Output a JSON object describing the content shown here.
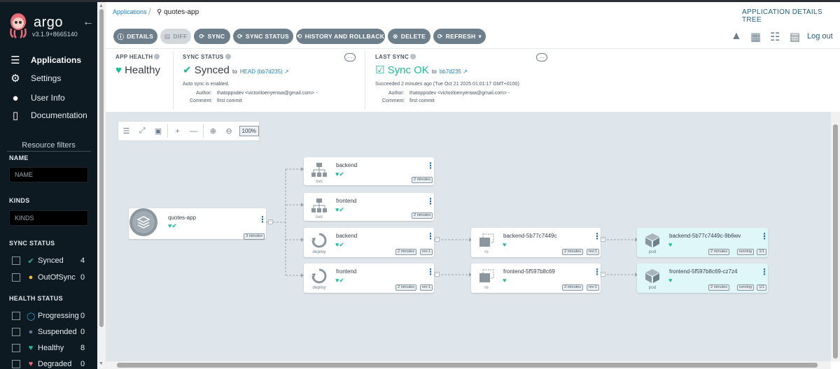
{
  "app": {
    "brand": "argo",
    "version": "v3.1.9+8665140"
  },
  "nav": [
    {
      "label": "Applications",
      "icon": "stack-icon"
    },
    {
      "label": "Settings",
      "icon": "gear-icon"
    },
    {
      "label": "User Info",
      "icon": "user-icon"
    },
    {
      "label": "Documentation",
      "icon": "book-icon"
    }
  ],
  "filters": {
    "title": "Resource filters",
    "name_label": "NAME",
    "name_placeholder": "NAME",
    "kinds_label": "KINDS",
    "kinds_placeholder": "KINDS",
    "sync_status_label": "SYNC STATUS",
    "sync_status": [
      {
        "label": "Synced",
        "count": "4",
        "icon": "check-circle-icon",
        "color": "#18be94"
      },
      {
        "label": "OutOfSync",
        "count": "0",
        "icon": "arrow-up-circle-icon",
        "color": "#f4c030"
      }
    ],
    "health_status_label": "HEALTH STATUS",
    "health_status": [
      {
        "label": "Progressing",
        "count": "0",
        "icon": "progress-icon",
        "color": "#0dadea"
      },
      {
        "label": "Suspended",
        "count": "0",
        "icon": "pause-icon",
        "color": "#766f94"
      },
      {
        "label": "Healthy",
        "count": "8",
        "icon": "heart-icon",
        "color": "#18be94"
      },
      {
        "label": "Degraded",
        "count": "0",
        "icon": "broken-heart-icon",
        "color": "#e96d76"
      }
    ]
  },
  "header": {
    "breadcrumb_root": "Applications",
    "app_name": "quotes-app",
    "view_title": "APPLICATION DETAILS TREE",
    "logout": "Log out"
  },
  "actions": [
    {
      "label": "DETAILS",
      "icon": "info-icon"
    },
    {
      "label": "DIFF",
      "icon": "file-icon",
      "disabled": true
    },
    {
      "label": "SYNC",
      "icon": "sync-icon"
    },
    {
      "label": "SYNC STATUS",
      "icon": "sync-icon"
    },
    {
      "label": "HISTORY AND ROLLBACK",
      "icon": "history-icon"
    },
    {
      "label": "DELETE",
      "icon": "delete-icon"
    },
    {
      "label": "REFRESH",
      "icon": "refresh-icon"
    }
  ],
  "health": {
    "label": "APP HEALTH",
    "value": "Healthy"
  },
  "sync_status": {
    "label": "SYNC STATUS",
    "value": "Synced",
    "to": "to",
    "revision": "HEAD (bb7d235)",
    "auto": "Auto sync is enabled.",
    "author_label": "Author:",
    "author": "thatoppsdev <victoriloenyenwa@gmail.com> -",
    "comment_label": "Comment:",
    "comment": "first commit"
  },
  "last_sync": {
    "label": "LAST SYNC",
    "value": "Sync OK",
    "to": "to",
    "revision": "bb7d235",
    "time": "Succeeded 2 minutes ago (Tue Oct 21 2025 01:01:17 GMT+0100)",
    "author_label": "Author:",
    "author": "thatoppsdev <victoriloenyenwa@gmail.com> -",
    "comment_label": "Comment:",
    "comment": "first commit"
  },
  "graph": {
    "zoom": "100%",
    "nodes": [
      {
        "id": "app",
        "name": "quotes-app",
        "kind": "",
        "age": "3 minutes"
      },
      {
        "id": "svc-backend",
        "name": "backend",
        "kind": "svc",
        "age": "2 minutes"
      },
      {
        "id": "svc-frontend",
        "name": "frontend",
        "kind": "svc",
        "age": "2 minutes"
      },
      {
        "id": "deploy-backend",
        "name": "backend",
        "kind": "deploy",
        "age": "2 minutes",
        "rev": "rev:1"
      },
      {
        "id": "deploy-frontend",
        "name": "frontend",
        "kind": "deploy",
        "age": "2 minutes",
        "rev": "rev:1"
      },
      {
        "id": "rs-backend",
        "name": "backend-5b77c7449c",
        "kind": "rs",
        "age": "2 minutes",
        "rev": "rev:1"
      },
      {
        "id": "rs-frontend",
        "name": "frontend-5f597b8c69",
        "kind": "rs",
        "age": "2 minutes",
        "rev": "rev:1"
      },
      {
        "id": "pod-backend",
        "name": "backend-5b77c7449c-9b6wv",
        "kind": "pod",
        "age": "2 minutes",
        "state": "running",
        "ready": "1/1"
      },
      {
        "id": "pod-frontend",
        "name": "frontend-5f597b8c69-cz7z4",
        "kind": "pod",
        "age": "2 minutes",
        "state": "running",
        "ready": "1/1"
      }
    ]
  }
}
